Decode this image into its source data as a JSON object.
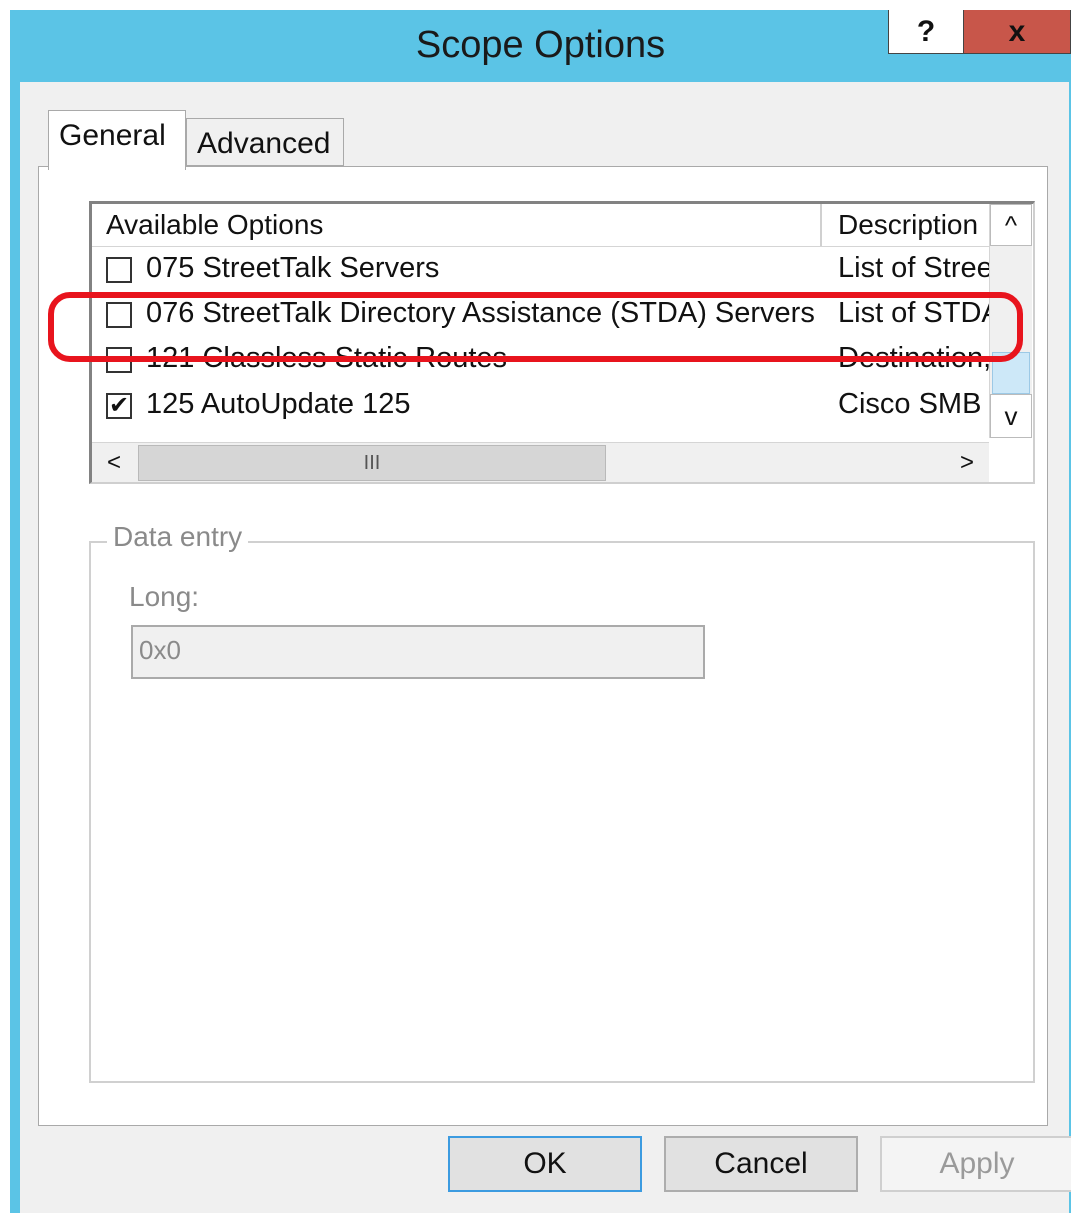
{
  "window": {
    "title": "Scope Options",
    "help_label": "?",
    "close_label": "x"
  },
  "tabs": [
    {
      "label": "General",
      "selected": true
    },
    {
      "label": "Advanced",
      "selected": false
    }
  ],
  "options_list": {
    "columns": [
      "Available Options",
      "Description"
    ],
    "rows": [
      {
        "checked": false,
        "checkbox": "",
        "name": "075 StreetTalk Servers",
        "description": "List of Street"
      },
      {
        "checked": false,
        "checkbox": "",
        "name": "076 StreetTalk Directory Assistance (STDA) Servers",
        "description": "List of STDA"
      },
      {
        "checked": false,
        "checkbox": "",
        "name": "121 Classless Static Routes",
        "description": "Destination,"
      },
      {
        "checked": true,
        "checkbox": "✔",
        "name": "125 AutoUpdate 125",
        "description": "Cisco SMB"
      }
    ],
    "scroll_up": "^",
    "scroll_down": "v",
    "scroll_left": "<",
    "scroll_right": ">",
    "hscroll_grip": "III"
  },
  "data_entry": {
    "legend": "Data entry",
    "field_label": "Long:",
    "field_value": "0x0"
  },
  "buttons": {
    "ok": "OK",
    "cancel": "Cancel",
    "apply": "Apply"
  },
  "colors": {
    "title_bar": "#5bc4e6",
    "close_button": "#c8564a",
    "highlight": "#e8141d"
  }
}
